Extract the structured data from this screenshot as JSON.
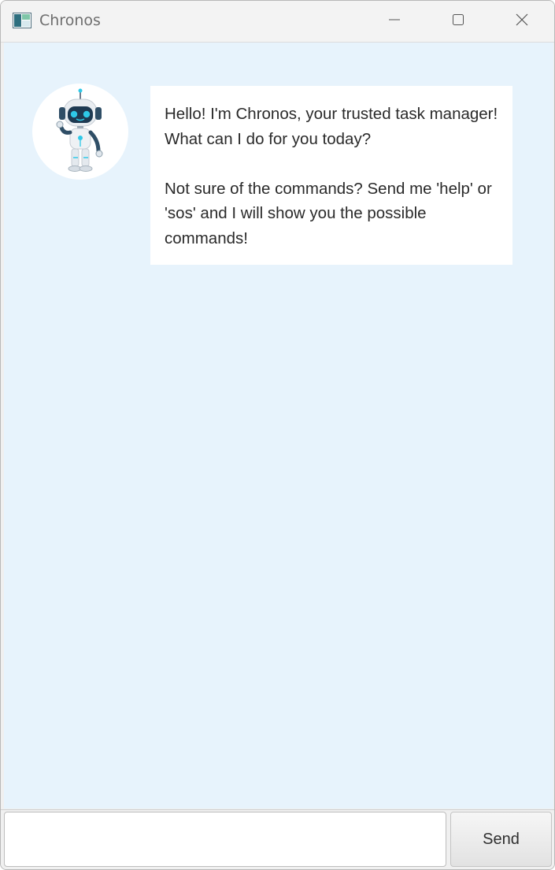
{
  "window": {
    "title": "Chronos",
    "icon": "app-window-icon"
  },
  "titlebar_controls": {
    "minimize_icon": "minimize-icon",
    "maximize_icon": "maximize-icon",
    "close_icon": "close-icon"
  },
  "chat": {
    "messages": [
      {
        "sender": "bot",
        "avatar_icon": "robot-icon",
        "text": "Hello! I'm Chronos, your trusted task manager! What can I do for you today?\n\nNot sure of the commands? Send me 'help' or 'sos' and I will show you the possible commands!"
      }
    ]
  },
  "input": {
    "value": "",
    "placeholder": ""
  },
  "send_button": {
    "label": "Send"
  },
  "colors": {
    "chat_background": "#e7f3fc",
    "bubble_background": "#ffffff",
    "robot_accent": "#2ec9e8"
  }
}
